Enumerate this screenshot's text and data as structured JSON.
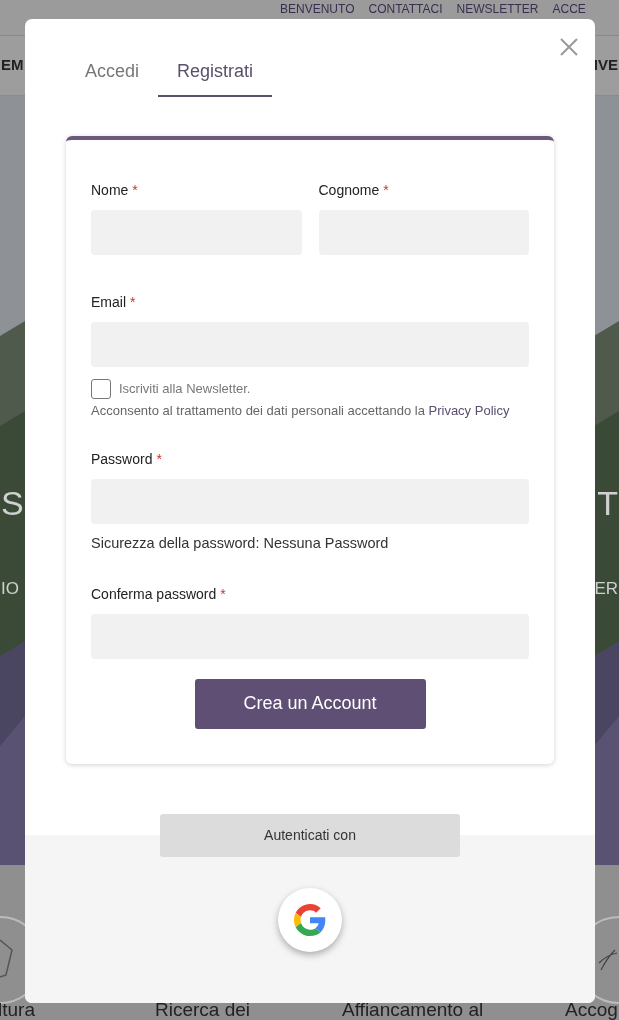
{
  "background": {
    "nav": [
      "BENVENUTO",
      "CONTATTACI",
      "NEWSLETTER",
      "ACCE"
    ],
    "menu_left": "EM",
    "menu_right": "IVE",
    "hero": {
      "kind": "picture",
      "left_title": "S",
      "right_title": "T",
      "left_subtitle": "IO",
      "right_subtitle": "ER"
    },
    "features": [
      "ltura",
      "Ricerca dei",
      "Affiancamento al",
      "Accog"
    ]
  },
  "modal": {
    "tabs": [
      {
        "label": "Accedi",
        "selected": false
      },
      {
        "label": "Registrati",
        "selected": true
      }
    ],
    "name_fields": [
      {
        "label": "Nome",
        "required_mark": "*"
      },
      {
        "label": "Cognome",
        "required_mark": "*"
      }
    ],
    "email": {
      "label": "Email",
      "required_mark": "*"
    },
    "newsletter": {
      "label": "Iscriviti alla Newsletter.",
      "checked": false
    },
    "consent": {
      "text": "Acconsento al trattamento dei dati personali accettando la",
      "link": "Privacy Policy"
    },
    "password": {
      "label": "Password",
      "required_mark": "*"
    },
    "password_strength": "Sicurezza della password: Nessuna Password",
    "confirm_password": {
      "label": "Conferma password",
      "required_mark": "*"
    },
    "submit": "Crea un Account",
    "social_label": "Autenticati con",
    "social": [
      {
        "kind": "google"
      }
    ]
  }
}
